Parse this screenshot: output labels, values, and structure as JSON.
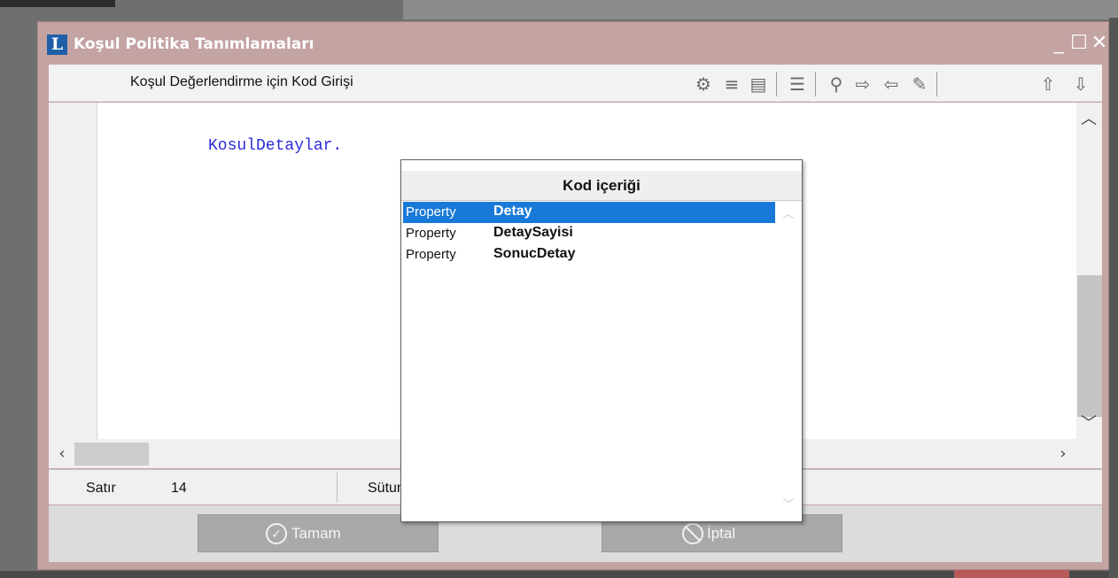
{
  "window": {
    "title": "Koşul Politika Tanımlamaları",
    "app_icon_letter": "L",
    "controls": {
      "minimize": "_",
      "maximize": "☐",
      "close": "✕"
    }
  },
  "editor": {
    "title": "Koşul Değerlendirme için Kod Girişi",
    "toolbar": [
      {
        "name": "format-icon",
        "glyph": "⚙"
      },
      {
        "name": "list-icon",
        "glyph": "≡"
      },
      {
        "name": "numbered-list-icon",
        "glyph": "▤"
      },
      {
        "name": "layout-icon",
        "glyph": "☰"
      },
      {
        "name": "search-icon",
        "glyph": "⚲"
      },
      {
        "name": "next-icon",
        "glyph": "⇨"
      },
      {
        "name": "previous-icon",
        "glyph": "⇦"
      },
      {
        "name": "edit-icon",
        "glyph": "✎"
      },
      {
        "name": "upload-icon",
        "glyph": "⇧"
      },
      {
        "name": "download-icon",
        "glyph": "⇩"
      }
    ],
    "code_line": "KosulDetaylar."
  },
  "status": {
    "row_label": "Satır",
    "row_value": "14",
    "col_label": "Sütun"
  },
  "buttons": {
    "ok_label": "Tamam",
    "cancel_label": "İptal"
  },
  "popup": {
    "title": "Kod içeriği",
    "items": [
      {
        "kind": "Property",
        "name": "Detay",
        "selected": true
      },
      {
        "kind": "Property",
        "name": "DetaySayisi",
        "selected": false
      },
      {
        "kind": "Property",
        "name": "SonucDetay",
        "selected": false
      }
    ]
  },
  "colors": {
    "window_frame": "#c4a3a3",
    "selection": "#1879d8",
    "code_text": "#2a2ad8"
  }
}
